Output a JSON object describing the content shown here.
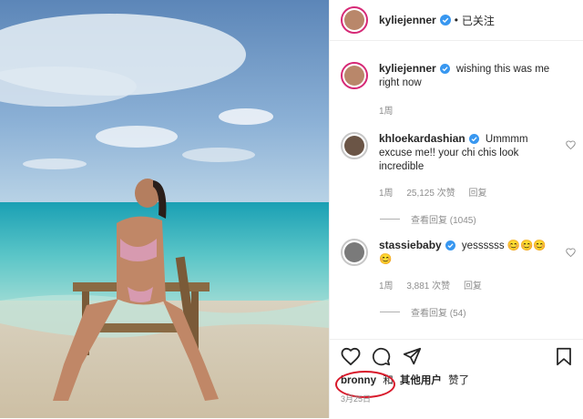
{
  "header": {
    "username": "kyliejenner",
    "dot": "•",
    "follow_status": "已关注"
  },
  "caption": {
    "username": "kyliejenner",
    "text": "wishing this was me right now",
    "age": "1周"
  },
  "comments": [
    {
      "username": "khloekardashian",
      "text": "Ummmm excuse me!! your chi chis look incredible",
      "age": "1周",
      "likes": "25,125 次赞",
      "reply": "回复",
      "view_replies": "查看回复 (1045)"
    },
    {
      "username": "stassiebaby",
      "text": "yessssss 😊😊😊 😊",
      "age": "1周",
      "likes": "3,881 次赞",
      "reply": "回复",
      "view_replies": "查看回复 (54)"
    }
  ],
  "likes": {
    "user": "bronny",
    "connector": "和",
    "others": "其他用户",
    "suffix": "赞了"
  },
  "date": "3月25日",
  "colors": {
    "verified": "#3897f0",
    "highlight_circle": "#d8182a",
    "meta": "#8e8e8e"
  },
  "icons": [
    "verified-badge-icon",
    "heart-icon",
    "comment-icon",
    "share-icon",
    "bookmark-icon"
  ]
}
